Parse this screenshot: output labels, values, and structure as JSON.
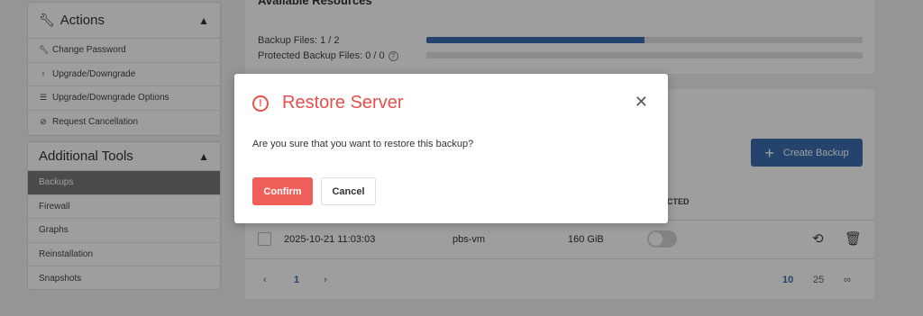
{
  "sidebar": {
    "actions": {
      "title": "Actions",
      "items": [
        {
          "label": "Change Password",
          "icon": "wrench-icon"
        },
        {
          "label": "Upgrade/Downgrade",
          "icon": "arrow-up-icon"
        },
        {
          "label": "Upgrade/Downgrade Options",
          "icon": "list-icon"
        },
        {
          "label": "Request Cancellation",
          "icon": "ban-icon"
        }
      ]
    },
    "tools": {
      "title": "Additional Tools",
      "items": [
        {
          "label": "Backups",
          "active": true
        },
        {
          "label": "Firewall"
        },
        {
          "label": "Graphs"
        },
        {
          "label": "Reinstallation"
        },
        {
          "label": "Snapshots"
        }
      ]
    }
  },
  "resources": {
    "title": "Available Resources",
    "backup_files_label": "Backup Files: 1 / 2",
    "backup_files_used": 1,
    "backup_files_total": 2,
    "protected_label": "Protected Backup Files: 0 / 0",
    "protected_used": 0,
    "protected_total": 0
  },
  "backups": {
    "create_label": "Create Backup",
    "protected_header": "ECTED",
    "rows": [
      {
        "date": "2025-10-21 11:03:03",
        "node": "pbs-vm",
        "size": "160 GiB",
        "protected": false
      }
    ],
    "pagination": {
      "pages": [
        "1"
      ],
      "current_page": "1",
      "page_sizes": [
        "10",
        "25",
        "∞"
      ],
      "current_size": "10"
    }
  },
  "modal": {
    "title": "Restore Server",
    "message": "Are you sure that you want to restore this backup?",
    "confirm_label": "Confirm",
    "cancel_label": "Cancel",
    "close_symbol": "✕"
  },
  "colors": {
    "accent": "#3d6fb0",
    "danger": "#e8504b",
    "confirm": "#f05e5a"
  }
}
